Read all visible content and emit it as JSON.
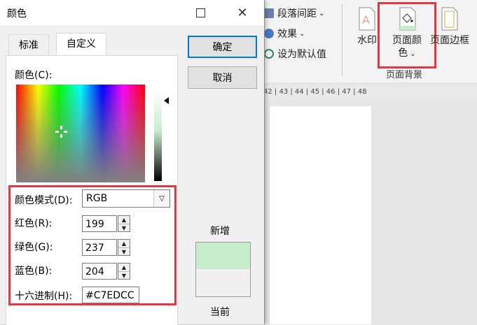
{
  "dialog": {
    "title": "颜色",
    "tabs": [
      "标准",
      "自定义"
    ],
    "color_label": "颜色(C):",
    "color_mode_label": "颜色模式(D):",
    "color_mode_value": "RGB",
    "red_label": "红色(R):",
    "red_value": "199",
    "green_label": "绿色(G):",
    "green_value": "237",
    "blue_label": "蓝色(B):",
    "blue_value": "204",
    "hex_label": "十六进制(H):",
    "hex_value": "#C7EDCC",
    "ok_label": "确定",
    "cancel_label": "取消",
    "new_label": "新增",
    "current_label": "当前",
    "new_color": "#C7EDCC",
    "current_color": "#F0F0F0"
  },
  "ribbon": {
    "paragraph_spacing": "段落间距",
    "effects": "效果",
    "set_default": "设为默认值",
    "watermark": "水印",
    "page_color_line1": "页面颜",
    "page_color_line2": "色",
    "page_border": "页面边框",
    "group_label": "页面背景",
    "ruler_text": "42 | 43 | 44 | 45 | 46 | 47 | 48"
  },
  "colors": {
    "highlight_red": "#EA3440",
    "accent_blue": "#0078D7"
  }
}
